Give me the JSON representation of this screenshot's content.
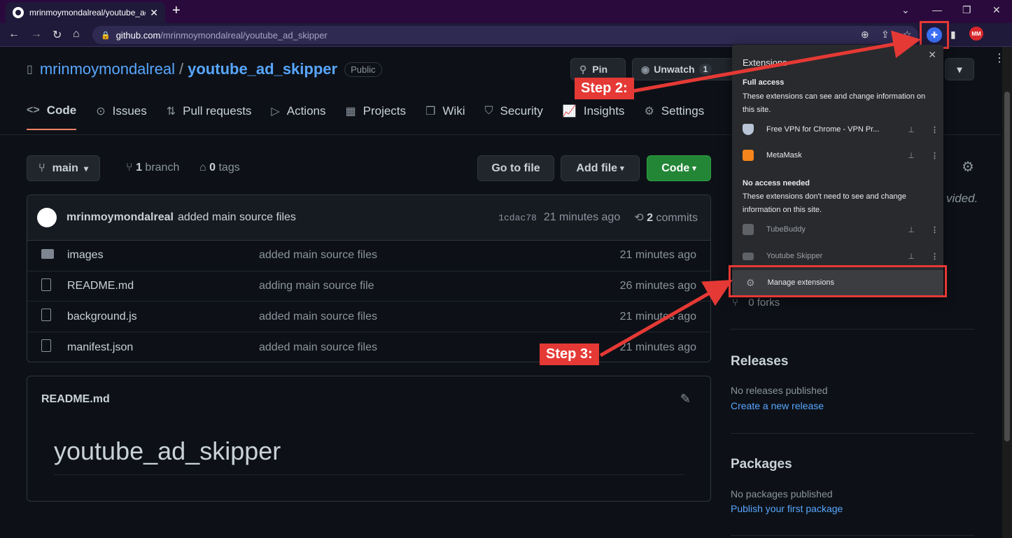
{
  "browser": {
    "tab_title": "mrinmoymondalreal/youtube_ad",
    "url_host": "github.com",
    "url_path": "/mrinmoymondalreal/youtube_ad_skipper",
    "avatar_text": "MM"
  },
  "repo": {
    "owner": "mrinmoymondalreal",
    "separator": "/",
    "name": "youtube_ad_skipper",
    "visibility": "Public",
    "pin_label": "Pin",
    "watch_label": "Unwatch",
    "watch_count": "1"
  },
  "nav": {
    "items": [
      {
        "label": "Code",
        "icon": "code-icon",
        "glyph": "<>"
      },
      {
        "label": "Issues",
        "icon": "issue-icon",
        "glyph": "⊙"
      },
      {
        "label": "Pull requests",
        "icon": "pull-request-icon",
        "glyph": "⇅"
      },
      {
        "label": "Actions",
        "icon": "play-icon",
        "glyph": "▷"
      },
      {
        "label": "Projects",
        "icon": "table-icon",
        "glyph": "▦"
      },
      {
        "label": "Wiki",
        "icon": "book-icon",
        "glyph": "❒"
      },
      {
        "label": "Security",
        "icon": "shield-icon",
        "glyph": "⛉"
      },
      {
        "label": "Insights",
        "icon": "graph-icon",
        "glyph": "📈"
      },
      {
        "label": "Settings",
        "icon": "gear-icon",
        "glyph": "⚙"
      }
    ]
  },
  "toolbar": {
    "branch": "main",
    "branch_count": "1",
    "branch_word": "branch",
    "tag_count": "0",
    "tag_word": "tags",
    "goto_file": "Go to file",
    "add_file": "Add file",
    "code": "Code"
  },
  "commit": {
    "author": "mrinmoymondalreal",
    "message": "added main source files",
    "sha": "1cdac78",
    "ago": "21 minutes ago",
    "commit_count": "2",
    "commit_word": "commits"
  },
  "files": [
    {
      "name": "images",
      "type": "folder",
      "message": "added main source files",
      "age": "21 minutes ago"
    },
    {
      "name": "README.md",
      "type": "file",
      "message": "adding main source file",
      "age": "26 minutes ago"
    },
    {
      "name": "background.js",
      "type": "file",
      "message": "added main source files",
      "age": "21 minutes ago"
    },
    {
      "name": "manifest.json",
      "type": "file",
      "message": "added main source files",
      "age": "21 minutes ago"
    }
  ],
  "readme": {
    "filename": "README.md",
    "heading": "youtube_ad_skipper"
  },
  "sidebar": {
    "partial_text": "vided.",
    "forks": "0 forks",
    "releases_title": "Releases",
    "releases_none": "No releases published",
    "releases_link": "Create a new release",
    "packages_title": "Packages",
    "packages_none": "No packages published",
    "packages_link": "Publish your first package"
  },
  "extensions_popup": {
    "title": "Extensions",
    "full_access_title": "Full access",
    "full_access_desc": "These extensions can see and change information on this site.",
    "no_access_title": "No access needed",
    "no_access_desc": "These extensions don't need to see and change information on this site.",
    "full_access_items": [
      {
        "name": "Free VPN for Chrome - VPN Pr...",
        "color": "#b8c4d6"
      },
      {
        "name": "MetaMask",
        "color": "#f6851b"
      }
    ],
    "no_access_items": [
      {
        "name": "TubeBuddy",
        "color": "#9aa0a6"
      },
      {
        "name": "Youtube Skipper",
        "color": "#9aa0a6"
      }
    ],
    "manage": "Manage extensions"
  },
  "annotations": {
    "step2": "Step 2:",
    "step3": "Step 3:",
    "color": "#e53935"
  }
}
